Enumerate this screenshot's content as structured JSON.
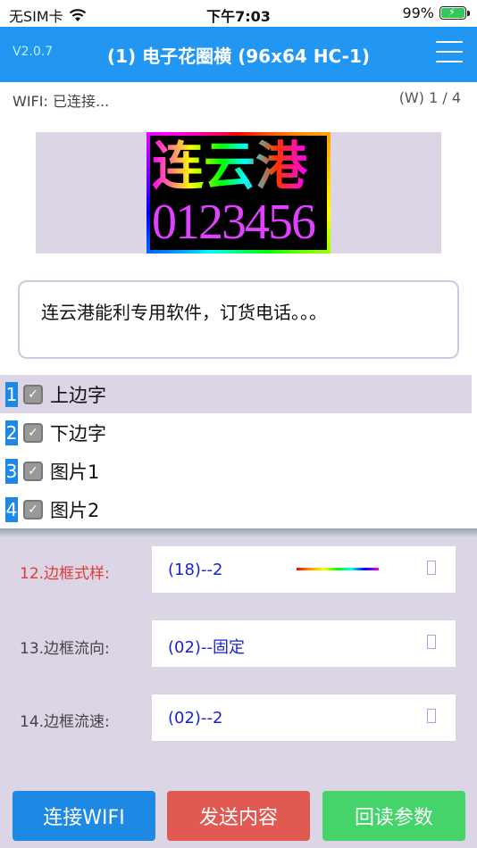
{
  "status_bar": {
    "carrier": "无SIM卡",
    "time": "下午7:03",
    "battery": "99%",
    "battery_level": 0.99
  },
  "header": {
    "version": "V2.0.7",
    "title": "(1) 电子花圈横 (96x64 HC-1)"
  },
  "info": {
    "wifi_status": "WIFI: 已连接...",
    "page_counter": "(W) 1 / 4"
  },
  "preview": {
    "line1": "连云港",
    "line2": "0123456"
  },
  "text_content": "连云港能利专用软件，订货电话。。。",
  "layers": [
    {
      "num": "1",
      "label": "上边字",
      "checked": true,
      "selected": true
    },
    {
      "num": "2",
      "label": "下边字",
      "checked": true,
      "selected": false
    },
    {
      "num": "3",
      "label": "图片1",
      "checked": true,
      "selected": false
    },
    {
      "num": "4",
      "label": "图片2",
      "checked": true,
      "selected": false
    }
  ],
  "settings": [
    {
      "label": "12.边框式样:",
      "value": "(18)--2",
      "active": true
    },
    {
      "label": "13.边框流向:",
      "value": "(02)--固定",
      "active": false
    },
    {
      "label": "14.边框流速:",
      "value": "(02)--2",
      "active": false
    }
  ],
  "buttons": {
    "connect": "连接WIFI",
    "send": "发送内容",
    "read": "回读参数"
  },
  "colors": {
    "primary": "#2196f3",
    "panel": "#dcd5e6",
    "active_label": "#e03a3a",
    "value_text": "#1a22d6",
    "send_button": "#e05a52",
    "read_button": "#45d46a"
  }
}
